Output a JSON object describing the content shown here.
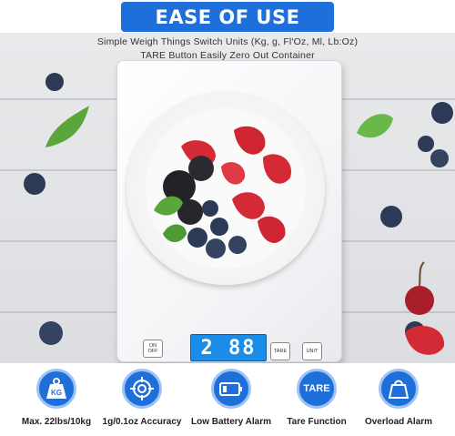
{
  "banner": {
    "title": "EASE OF USE"
  },
  "subtitle": {
    "line1": "Simple Weigh Things Switch Units  (Kg, g, Fl'Oz, Ml, Lb:Oz)",
    "line2": "TARE Button Easily Zero Out  Container"
  },
  "scale": {
    "on_off_label": "ON OFF",
    "display_value": "2 88",
    "tare_label": "TARE",
    "unit_label": "UNIT"
  },
  "features": [
    {
      "icon": "weight-kg-icon",
      "icon_text": "KG",
      "label": "Max. 22lbs/10kg"
    },
    {
      "icon": "target-icon",
      "icon_text": "",
      "label": "1g/0.1oz Accuracy"
    },
    {
      "icon": "battery-icon",
      "icon_text": "",
      "label": "Low Battery Alarm"
    },
    {
      "icon": "tare-icon",
      "icon_text": "TARE",
      "label": "Tare Function"
    },
    {
      "icon": "overload-icon",
      "icon_text": "",
      "label": "Overload Alarm"
    }
  ],
  "colors": {
    "accent": "#1e6fd9",
    "lcd": "#1b8de8",
    "strawberry": "#d42a36",
    "blueberry": "#2c3a55",
    "leaf": "#5aa63a"
  }
}
